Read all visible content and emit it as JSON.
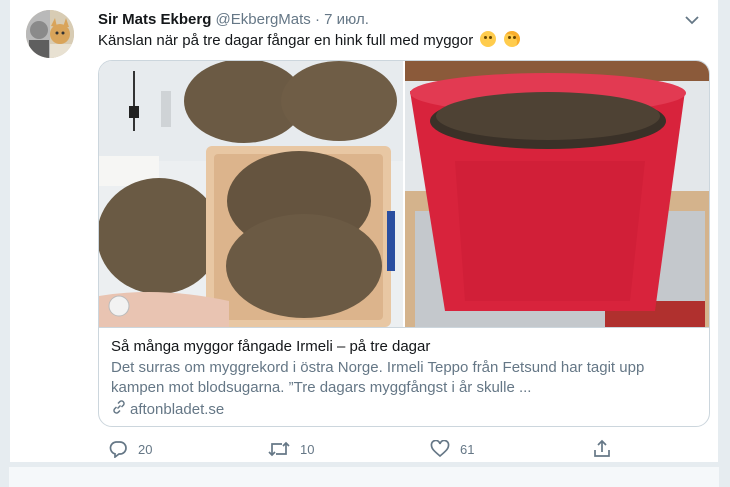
{
  "tweet": {
    "author_name": "Sir Mats Ekberg",
    "handle": "@EkbergMats",
    "separator": "·",
    "date": "7 июл.",
    "text": "Känslan när på tre dagar fångar en hink full med myggor",
    "emojis": [
      "thinking-face",
      "flushed-face"
    ]
  },
  "card": {
    "title": "Så många myggor fångade Irmeli – på tre dagar",
    "description": "Det surras om myggrekord i östra Norge. Irmeli Teppo från Fetsund har tagit upp kampen mot blodsugarna. ”Tre dagars myggfångst i år skulle ...",
    "domain": "aftonbladet.se"
  },
  "actions": {
    "replies": "20",
    "retweets": "10",
    "likes": "61"
  },
  "colors": {
    "text": "#14171a",
    "secondary": "#657786",
    "border": "#ccd6dd",
    "background": "#e6ecf0"
  }
}
